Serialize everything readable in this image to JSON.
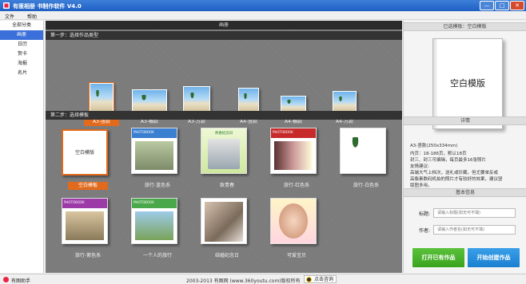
{
  "window": {
    "title": "有匪相册 书制作软件 V4.0",
    "controls": [
      "—",
      "□",
      "✕"
    ]
  },
  "menu": [
    "文件",
    "帮助"
  ],
  "sidebar": {
    "header": "全部分类",
    "items": [
      {
        "label": "画册",
        "active": true
      },
      {
        "label": "日历",
        "active": false
      },
      {
        "label": "贺卡",
        "active": false
      },
      {
        "label": "海报",
        "active": false
      },
      {
        "label": "名片",
        "active": false
      }
    ]
  },
  "center": {
    "header": "画册",
    "step1": "第一步：选择作品类型",
    "step2": "第二步：选择模板",
    "sizes": [
      {
        "label": "A3-竖款",
        "selected": true
      },
      {
        "label": "A3-横款",
        "selected": false
      },
      {
        "label": "A3-方款",
        "selected": false
      },
      {
        "label": "A4-竖款",
        "selected": false
      },
      {
        "label": "A4-横款",
        "selected": false
      },
      {
        "label": "A4-方款",
        "selected": false
      }
    ],
    "templates": [
      {
        "label": "空白模板",
        "selected": true,
        "cover_text": "空白模版"
      },
      {
        "label": "旅行-蓝色系",
        "selected": false,
        "cover_text": "PHOTOBOOK"
      },
      {
        "label": "致青春",
        "selected": false,
        "cover_text": "青春纪念日"
      },
      {
        "label": "旅行-红色系",
        "selected": false,
        "cover_text": "PHOTOBOOK"
      },
      {
        "label": "旅行-白色系",
        "selected": false,
        "cover_text": ""
      },
      {
        "label": "旅行-紫色系",
        "selected": false,
        "cover_text": "PHOTOBOOK"
      },
      {
        "label": "一个人的旅行",
        "selected": false,
        "cover_text": "PHOTOBOOK"
      },
      {
        "label": "结婚纪念日",
        "selected": false,
        "cover_text": ""
      },
      {
        "label": "可爱宝贝",
        "selected": false,
        "cover_text": ""
      }
    ]
  },
  "right": {
    "selected_header": "已选模板：空白模版",
    "preview_text": "空白模版",
    "details_header": "详情",
    "details_lines": [
      "A3-竖款(250x334mm)",
      "内页：18-186页，默认18页",
      "封三、封三可编辑，每页最多16张照片",
      "友情建议:",
      "高端大气上档次，送礼或珍藏。但尤要单反或",
      "高像素数码机拍的照片才有较好的效果，建议竖",
      "版图多用。"
    ],
    "basic_header": "基本信息",
    "title_label": "标题:",
    "title_placeholder": "请输入标题(如无可不填)",
    "author_label": "作者:",
    "author_placeholder": "请输入作者名(如无可不填)",
    "open_button": "打开已有作品",
    "create_button": "开始创建作品"
  },
  "status": {
    "app_name": "有图助手",
    "copyright": "2003-2013 有图网 (www.360youtu.com)版权所有",
    "qq_label": "点击咨询"
  },
  "colors": {
    "accent": "#e26a1c",
    "titlebar": "#2a6ccf",
    "green": "#4bb42c",
    "blue": "#2a90dc"
  }
}
